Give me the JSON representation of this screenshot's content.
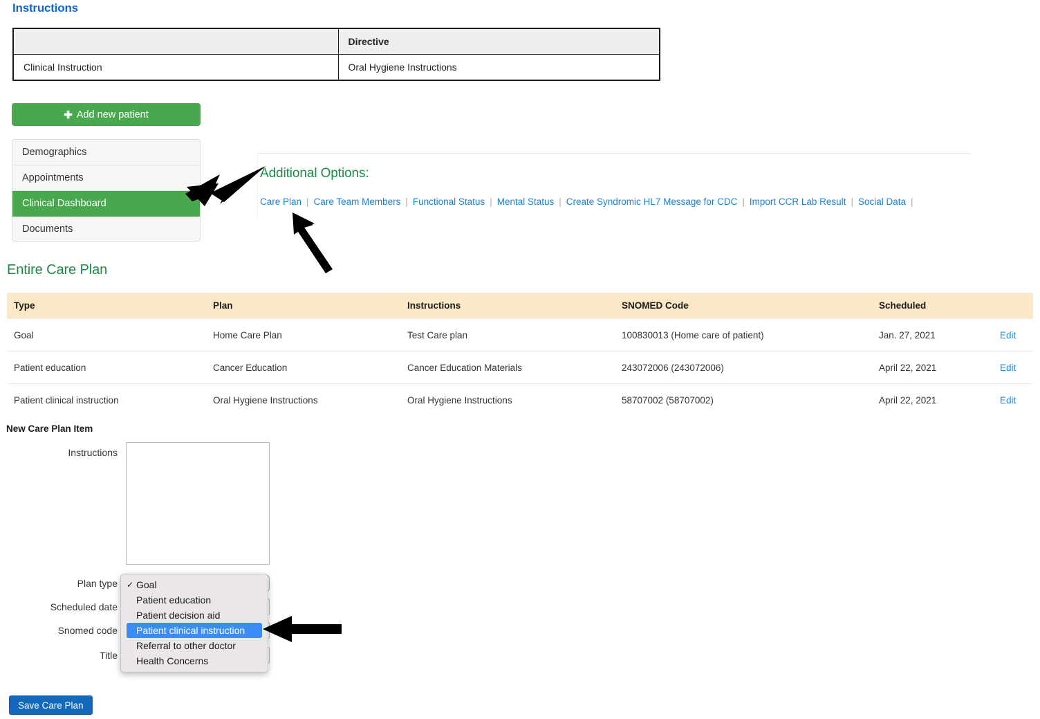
{
  "instructions_section": {
    "heading": "Instructions",
    "table": {
      "headers": [
        "",
        "Directive"
      ],
      "rows": [
        [
          "Clinical Instruction",
          "Oral Hygiene Instructions"
        ]
      ]
    }
  },
  "sidebar": {
    "add_patient_label": "Add new patient",
    "add_patient_icon": "plus-icon",
    "items": [
      {
        "label": "Demographics",
        "active": false
      },
      {
        "label": "Appointments",
        "active": false
      },
      {
        "label": "Clinical Dashboard",
        "active": true
      },
      {
        "label": "Documents",
        "active": false
      }
    ]
  },
  "additional_options": {
    "title": "Additional Options:",
    "links": [
      "Care Plan",
      "Care Team Members",
      "Functional Status",
      "Mental Status",
      "Create Syndromic HL7 Message for CDC",
      "Import CCR Lab Result",
      "Social Data"
    ],
    "separator": "|"
  },
  "care_plan": {
    "title": "Entire Care Plan",
    "columns": [
      "Type",
      "Plan",
      "Instructions",
      "SNOMED Code",
      "Scheduled",
      ""
    ],
    "rows": [
      {
        "type": "Goal",
        "plan": "Home Care Plan",
        "instructions": "Test Care plan",
        "snomed": "100830013 (Home care of patient)",
        "scheduled": "Jan. 27, 2021",
        "edit": "Edit"
      },
      {
        "type": "Patient education",
        "plan": "Cancer Education",
        "instructions": "Cancer Education Materials",
        "snomed": "243072006 (243072006)",
        "scheduled": "April 22, 2021",
        "edit": "Edit"
      },
      {
        "type": "Patient clinical instruction",
        "plan": "Oral Hygiene Instructions",
        "instructions": "Oral Hygiene Instructions",
        "snomed": "58707002 (58707002)",
        "scheduled": "April 22, 2021",
        "edit": "Edit"
      }
    ]
  },
  "new_item_form": {
    "title": "New Care Plan Item",
    "labels": {
      "instructions": "Instructions",
      "plan_type": "Plan type",
      "scheduled_date": "Scheduled date",
      "snomed_code": "Snomed code",
      "title": "Title"
    },
    "values": {
      "instructions": "",
      "plan_type": "Goal",
      "scheduled_date": "",
      "snomed_code": "",
      "title": ""
    },
    "plan_type_options": [
      {
        "label": "Goal",
        "selected_check": true,
        "highlighted": false
      },
      {
        "label": "Patient education",
        "selected_check": false,
        "highlighted": false
      },
      {
        "label": "Patient decision aid",
        "selected_check": false,
        "highlighted": false
      },
      {
        "label": "Patient clinical instruction",
        "selected_check": false,
        "highlighted": true
      },
      {
        "label": "Referral to other doctor",
        "selected_check": false,
        "highlighted": false
      },
      {
        "label": "Health Concerns",
        "selected_check": false,
        "highlighted": false
      }
    ],
    "checkmark": "✓",
    "save_label": "Save Care Plan"
  },
  "colors": {
    "brand_green": "#48a84e",
    "heading_green": "#1e8b45",
    "link_blue": "#1b7fd4",
    "heading_blue": "#1266cc",
    "table_header_cream": "#fbe8c6",
    "save_blue": "#1269bc",
    "dropdown_highlight": "#3b8cf7"
  }
}
